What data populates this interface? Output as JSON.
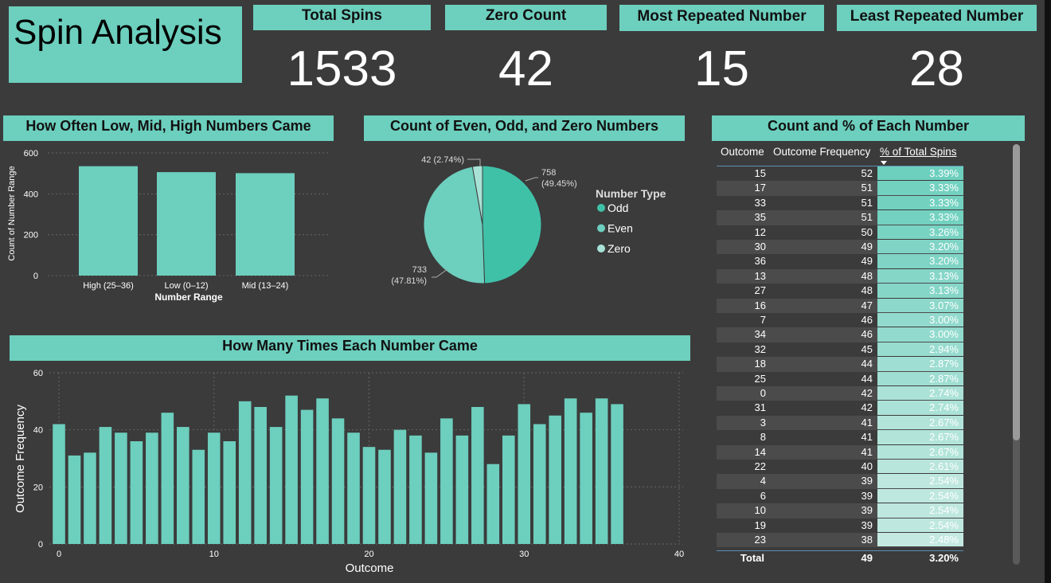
{
  "title": "Spin Analysis",
  "kpis": [
    {
      "label": "Total Spins",
      "value": "1533"
    },
    {
      "label": "Zero Count",
      "value": "42"
    },
    {
      "label": "Most Repeated Number",
      "value": "15"
    },
    {
      "label": "Least Repeated Number",
      "value": "28"
    }
  ],
  "colors": {
    "background": "#3b3b3b",
    "accent": "#6dcfbe",
    "odd": "#3fc1a8",
    "even": "#6dcfbe",
    "zero": "#a8e2d6"
  },
  "chart_data": [
    {
      "type": "bar",
      "title": "How Often Low, Mid, High Numbers Came",
      "categories": [
        "High (25–36)",
        "Low (0–12)",
        "Mid (13–24)"
      ],
      "values": [
        535,
        506,
        501
      ],
      "xlabel": "Number Range",
      "ylabel": "Count of Number Range",
      "ylim": [
        0,
        600
      ],
      "yticks": [
        0,
        200,
        400,
        600
      ],
      "grid": true
    },
    {
      "type": "pie",
      "title": "Count of Even, Odd, and Zero Numbers",
      "legend_title": "Number Type",
      "legend_position": "right",
      "slices": [
        {
          "name": "Odd",
          "value": 758,
          "label": "758",
          "pct": "(49.45%)"
        },
        {
          "name": "Even",
          "value": 733,
          "label": "733",
          "pct": "(47.81%)"
        },
        {
          "name": "Zero",
          "value": 42,
          "label": "42 (2.74%)",
          "pct": ""
        }
      ]
    },
    {
      "type": "bar",
      "title": "How Many Times Each Number Came",
      "x": [
        0,
        1,
        2,
        3,
        4,
        5,
        6,
        7,
        8,
        9,
        10,
        11,
        12,
        13,
        14,
        15,
        16,
        17,
        18,
        19,
        20,
        21,
        22,
        23,
        24,
        25,
        26,
        27,
        28,
        29,
        30,
        31,
        32,
        33,
        34,
        35,
        36
      ],
      "values": [
        42,
        31,
        32,
        41,
        39,
        36,
        39,
        46,
        41,
        33,
        39,
        36,
        50,
        48,
        41,
        52,
        47,
        51,
        44,
        39,
        34,
        33,
        40,
        38,
        32,
        44,
        38,
        48,
        28,
        38,
        49,
        42,
        45,
        51,
        46,
        51,
        49
      ],
      "xlabel": "Outcome",
      "ylabel": "Outcome Frequency",
      "xlim": [
        0,
        40
      ],
      "xticks": [
        0,
        10,
        20,
        30,
        40
      ],
      "ylim": [
        0,
        60
      ],
      "yticks": [
        0,
        20,
        40,
        60
      ],
      "grid": true
    }
  ],
  "table": {
    "title": "Count and % of Each Number",
    "headers": [
      "Outcome",
      "Outcome Frequency",
      "% of Total Spins"
    ],
    "rows": [
      [
        "15",
        "52",
        "3.39%"
      ],
      [
        "17",
        "51",
        "3.33%"
      ],
      [
        "33",
        "51",
        "3.33%"
      ],
      [
        "35",
        "51",
        "3.33%"
      ],
      [
        "12",
        "50",
        "3.26%"
      ],
      [
        "30",
        "49",
        "3.20%"
      ],
      [
        "36",
        "49",
        "3.20%"
      ],
      [
        "13",
        "48",
        "3.13%"
      ],
      [
        "27",
        "48",
        "3.13%"
      ],
      [
        "16",
        "47",
        "3.07%"
      ],
      [
        "7",
        "46",
        "3.00%"
      ],
      [
        "34",
        "46",
        "3.00%"
      ],
      [
        "32",
        "45",
        "2.94%"
      ],
      [
        "18",
        "44",
        "2.87%"
      ],
      [
        "25",
        "44",
        "2.87%"
      ],
      [
        "0",
        "42",
        "2.74%"
      ],
      [
        "31",
        "42",
        "2.74%"
      ],
      [
        "3",
        "41",
        "2.67%"
      ],
      [
        "8",
        "41",
        "2.67%"
      ],
      [
        "14",
        "41",
        "2.67%"
      ],
      [
        "22",
        "40",
        "2.61%"
      ],
      [
        "4",
        "39",
        "2.54%"
      ],
      [
        "6",
        "39",
        "2.54%"
      ],
      [
        "10",
        "39",
        "2.54%"
      ],
      [
        "19",
        "39",
        "2.54%"
      ],
      [
        "23",
        "38",
        "2.48%"
      ]
    ],
    "total": {
      "label": "Total",
      "freq": "49",
      "pct": "3.20%"
    }
  }
}
